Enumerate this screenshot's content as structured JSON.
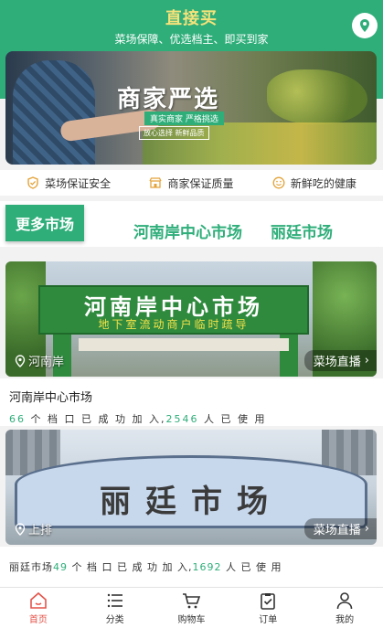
{
  "header": {
    "title": "直接买",
    "subtitle": "菜场保障、优选档主、即买到家",
    "location_icon": "location-pin-icon"
  },
  "banner": {
    "title": "商家严选",
    "tag": "真实商家  严格挑选",
    "sub": "放心选择  新鲜品质",
    "dots": 3,
    "active_dot": 2
  },
  "features": [
    {
      "icon": "shield-icon",
      "label": "菜场保证安全"
    },
    {
      "icon": "store-icon",
      "label": "商家保证质量"
    },
    {
      "icon": "smile-icon",
      "label": "新鲜吃的健康"
    }
  ],
  "market_tabs": {
    "more_label": "更多市场",
    "tab_a": "河南岸中心市场",
    "tab_b": "丽廷市场"
  },
  "markets": [
    {
      "sign": "河南岸中心市场",
      "sign_sub": "地下室流动商户临时疏导",
      "location": "河南岸",
      "live_label": "菜场直播",
      "name": "河南岸中心市场",
      "stall_count": "66",
      "stall_text": " 个 档 口 已 成 功 加 入,",
      "user_count": "2546",
      "user_text": " 人 已 使 用"
    },
    {
      "sign": "丽廷市场",
      "location": "上排",
      "live_label": "菜场直播",
      "name": "丽廷市场",
      "stall_count": "49",
      "stall_text": " 个 档 口 已 成 功 加 入,",
      "user_count": "1692",
      "user_text": " 人 已 使 用"
    }
  ],
  "bottom_nav": [
    {
      "icon": "home-icon",
      "label": "首页",
      "active": true
    },
    {
      "icon": "category-list-icon",
      "label": "分类",
      "active": false
    },
    {
      "icon": "cart-icon",
      "label": "购物车",
      "active": false
    },
    {
      "icon": "order-clipboard-icon",
      "label": "订单",
      "active": false
    },
    {
      "icon": "user-icon",
      "label": "我的",
      "active": false
    }
  ],
  "colors": {
    "brand_green": "#2fae7a",
    "title_yellow": "#f6e27a",
    "active_red": "#e4544a"
  }
}
